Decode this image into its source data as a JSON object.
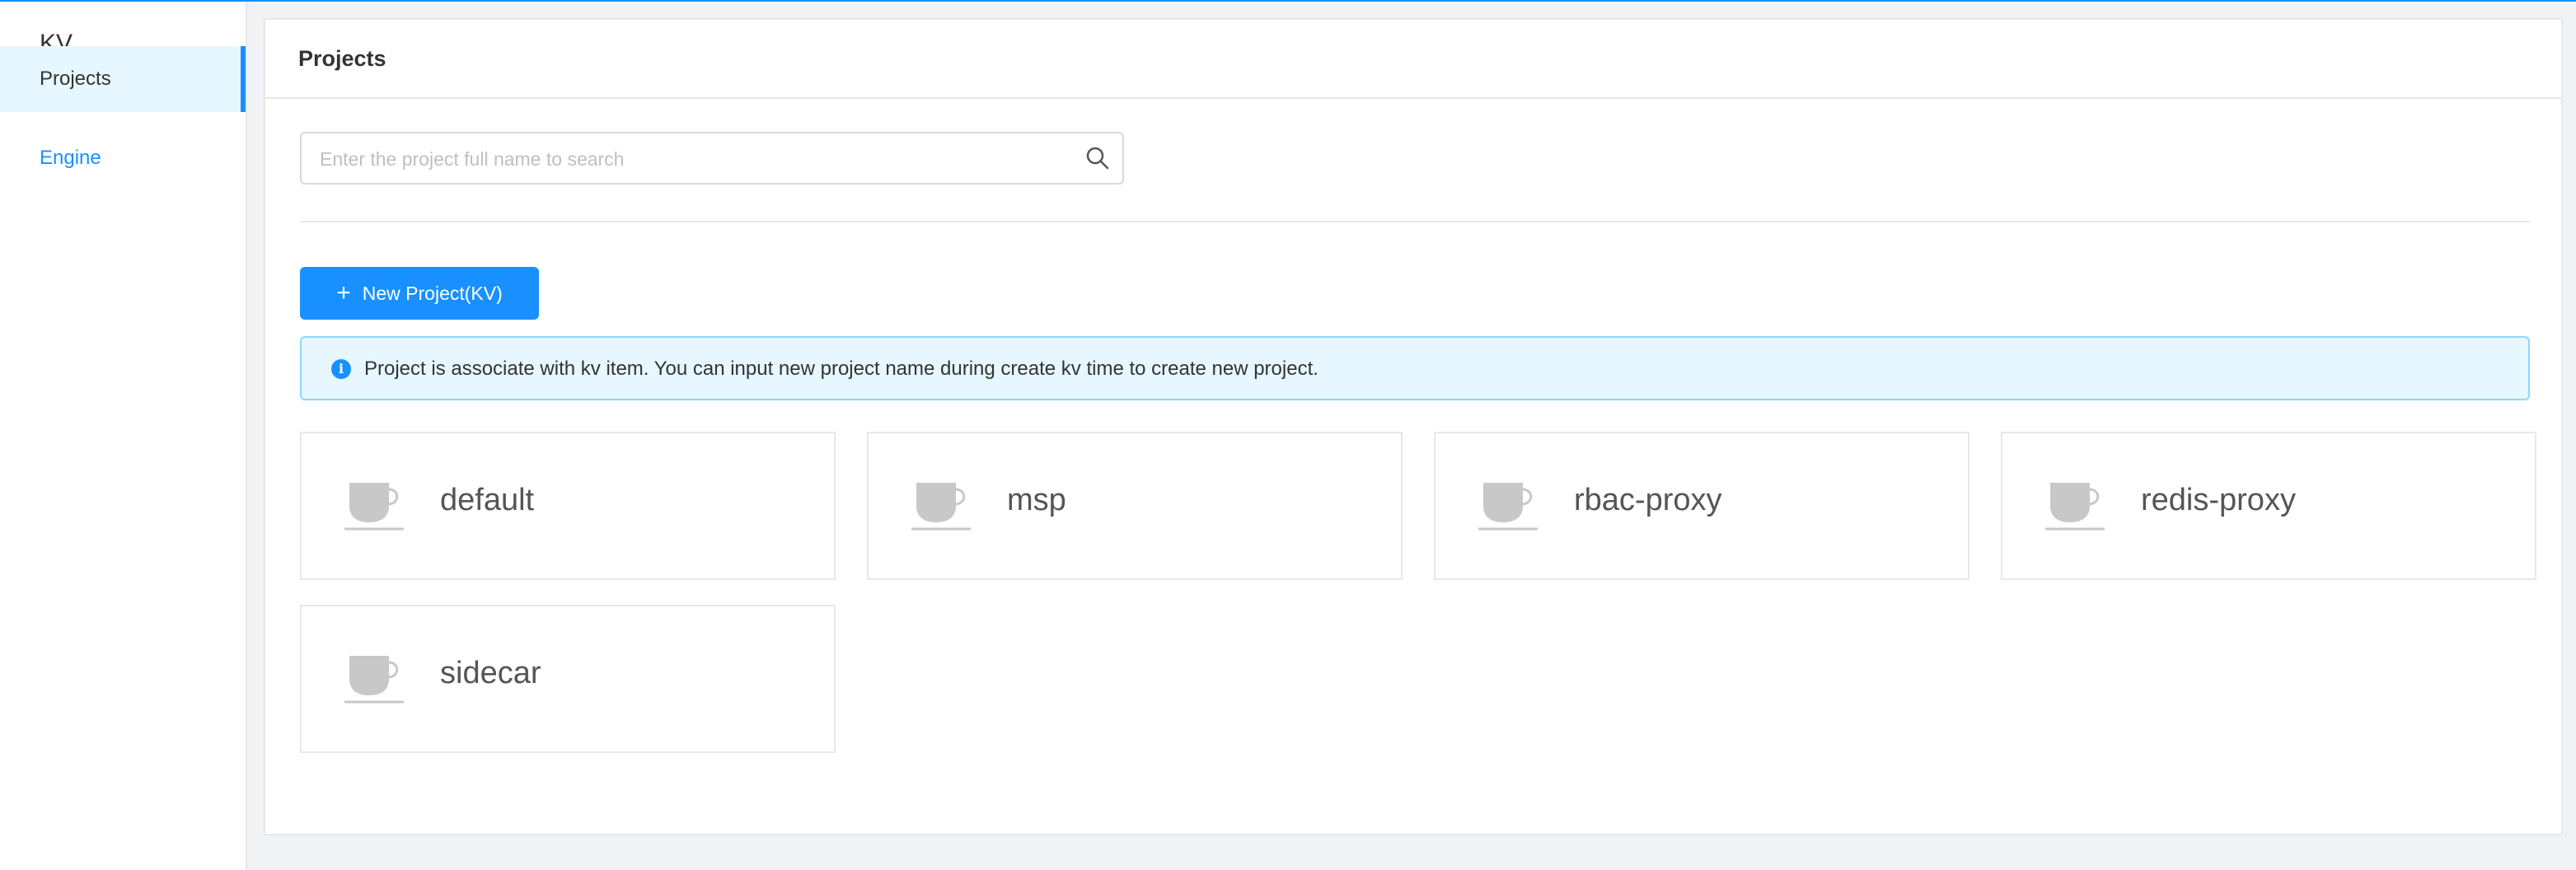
{
  "sidebar": {
    "app_title": "KV",
    "items": [
      {
        "label": "Projects",
        "active": true
      },
      {
        "label": "Engine",
        "active": false
      }
    ]
  },
  "main": {
    "title": "Projects",
    "search": {
      "placeholder": "Enter the project full name to search",
      "value": "",
      "icon": "search-icon"
    },
    "new_button": {
      "icon": "plus-icon",
      "label": "New Project(KV)"
    },
    "alert": {
      "icon": "info-icon",
      "text": "Project is associate with kv item. You can input new project name during create kv time to create new project."
    },
    "projects": [
      {
        "name": "default",
        "icon": "cup-icon"
      },
      {
        "name": "msp",
        "icon": "cup-icon"
      },
      {
        "name": "rbac-proxy",
        "icon": "cup-icon"
      },
      {
        "name": "redis-proxy",
        "icon": "cup-icon"
      },
      {
        "name": "sidecar",
        "icon": "cup-icon"
      }
    ]
  },
  "colors": {
    "accent": "#1890ff",
    "alert_bg": "#e6f7ff",
    "alert_border": "#91d5ff",
    "page_bg": "#f0f2f5"
  }
}
